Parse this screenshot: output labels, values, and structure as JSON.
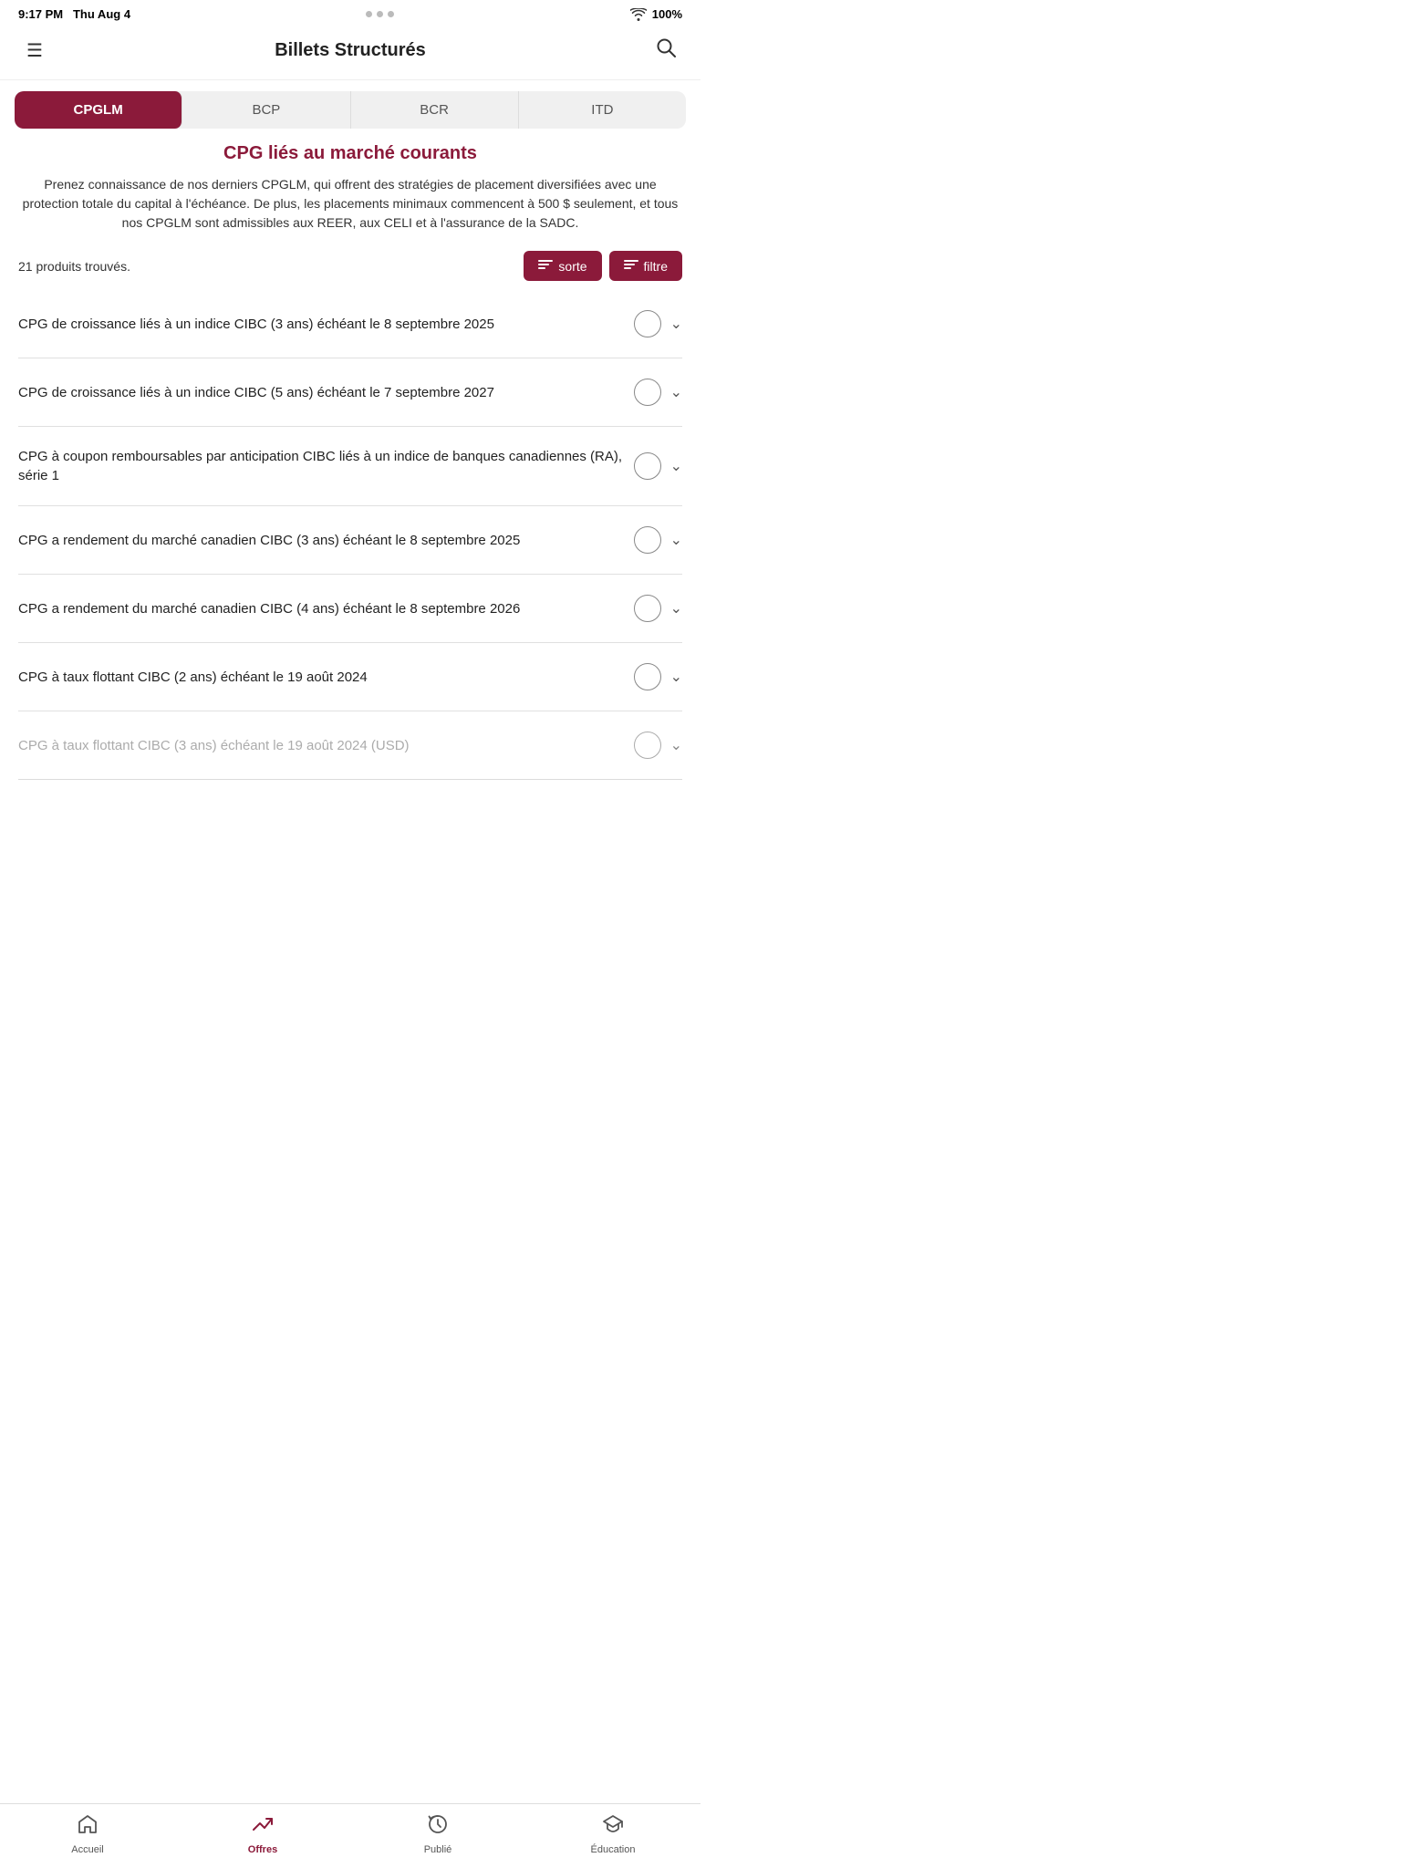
{
  "status_bar": {
    "time": "9:17 PM",
    "date": "Thu Aug 4",
    "battery": "100%"
  },
  "header": {
    "title": "Billets Structurés",
    "menu_label": "Menu",
    "search_label": "Recherche"
  },
  "tabs": [
    {
      "id": "cpglm",
      "label": "CPGLM",
      "active": true
    },
    {
      "id": "bcp",
      "label": "BCP",
      "active": false
    },
    {
      "id": "bcr",
      "label": "BCR",
      "active": false
    },
    {
      "id": "itd",
      "label": "ITD",
      "active": false
    }
  ],
  "section": {
    "title": "CPG liés au marché courants",
    "description": "Prenez connaissance de nos derniers CPGLM, qui offrent des stratégies de placement diversifiées avec une protection totale du capital à l'échéance. De plus, les placements minimaux commencent à 500 $ seulement, et tous nos CPGLM sont admissibles aux REER, aux CELI et à l'assurance de la SADC."
  },
  "filter_bar": {
    "count_text": "21 produits trouvés.",
    "sort_label": "sorte",
    "filter_label": "filtre"
  },
  "products": [
    {
      "id": 1,
      "text": "CPG de croissance liés à un indice CIBC (3 ans) échéant le 8 septembre 2025"
    },
    {
      "id": 2,
      "text": "CPG de croissance liés à un indice CIBC (5 ans) échéant le 7 septembre 2027"
    },
    {
      "id": 3,
      "text": "CPG à coupon remboursables par anticipation CIBC liés à un indice de banques canadiennes (RA), série 1"
    },
    {
      "id": 4,
      "text": "CPG a rendement du marché canadien CIBC (3 ans) échéant le 8 septembre 2025"
    },
    {
      "id": 5,
      "text": "CPG a rendement du marché canadien CIBC (4 ans) échéant le 8 septembre 2026"
    },
    {
      "id": 6,
      "text": "CPG à taux flottant CIBC (2 ans) échéant le 19 août 2024"
    },
    {
      "id": 7,
      "text": "CPG à taux flottant CIBC (3 ans) échéant le 19 août 2024 (USD)"
    }
  ],
  "bottom_nav": [
    {
      "id": "accueil",
      "label": "Accueil",
      "icon": "home",
      "active": false
    },
    {
      "id": "offres",
      "label": "Offres",
      "icon": "trending_up",
      "active": true
    },
    {
      "id": "publie",
      "label": "Publié",
      "icon": "history",
      "active": false
    },
    {
      "id": "education",
      "label": "Éducation",
      "icon": "school",
      "active": false
    }
  ]
}
